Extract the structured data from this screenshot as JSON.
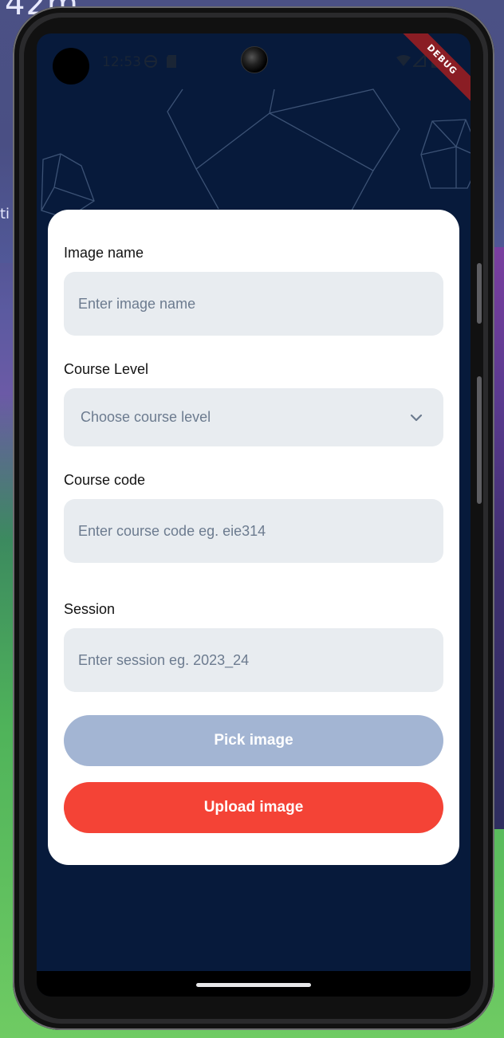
{
  "desktop_bg": {
    "text": "42m",
    "side_text": "ti"
  },
  "status_bar": {
    "time": "12:53",
    "debug_label": "DEBUG"
  },
  "form": {
    "image_name": {
      "label": "Image name",
      "placeholder": "Enter image name"
    },
    "course_level": {
      "label": "Course Level",
      "placeholder": "Choose course level"
    },
    "course_code": {
      "label": "Course code",
      "placeholder": "Enter course code eg. eie314"
    },
    "session": {
      "label": "Session",
      "placeholder": "Enter session eg. 2023_24"
    }
  },
  "buttons": {
    "pick_image": "Pick image",
    "upload_image": "Upload image"
  },
  "colors": {
    "screen_bg": "#071a3b",
    "field_bg": "#e8ecf0",
    "pick_button": "#a3b5d3",
    "upload_button": "#f44336"
  }
}
